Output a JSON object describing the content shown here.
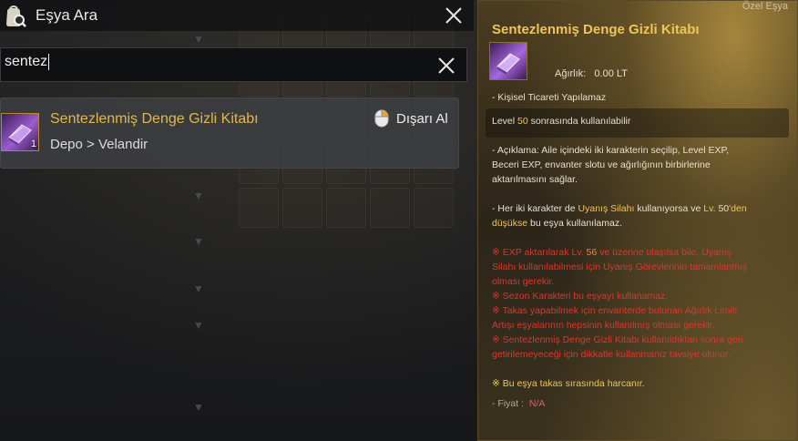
{
  "window": {
    "title": "Eşya Ara"
  },
  "search": {
    "value": "sentez"
  },
  "result": {
    "item_name": "Sentezlenmiş Denge Gizli Kitabı",
    "count": "1",
    "location": "Depo > Velandir",
    "action_label": "Dışarı Al"
  },
  "tooltip": {
    "category": "Özel Eşya",
    "title": "Sentezlenmiş Denge Gizli Kitabı",
    "weight_label": "Ağırlık:",
    "weight_value": "0.00 LT",
    "trade": "- Kişisel Ticareti Yapılamaz",
    "level_prefix": "Level",
    "level_value": "50",
    "level_suffix": "sonrasında kullanılabilir",
    "desc_line1": "- Açıklama: Aile içindeki iki karakterin seçilip, Level EXP,",
    "desc_line2": "Beceri EXP, envanter slotu ve ağırlığının birbirlerine",
    "desc_line3": "aktarılmasını sağlar.",
    "awak_pre": "- Her iki karakter de",
    "awak_weapon": "Uyanış Silahı",
    "awak_mid": "kullanıyorsa ve",
    "awak_lv": "Lv.",
    "awak_lvnum": "50",
    "awak_den": "'den",
    "awak_low": "düşükse",
    "awak_post": "bu eşya kullanılamaz.",
    "warn1_pre": "※ EXP aktarılarak Lv.",
    "warn1_num": "56",
    "warn1_post": "ve üzerine ulaşılsa bile, Uyanış",
    "warn1_line2": "Silahı kullanılabilmesi için Uyanış Görevlerinin tamamlanmış",
    "warn1_line3": "olması gerekir.",
    "warn2": "※ Sezon Karakteri bu eşyayı kullanamaz.",
    "warn3_line1": "※ Takas yapabilmek için envanterde bulunan Ağırlık Limiti",
    "warn3_line2": "Artışı eşyalarının hepsinin kullanılmış olması gerekir.",
    "warn4_line1": "※ Sentezlenmiş Denge Gizli Kitabı kullanıldıktan sonra geri",
    "warn4_line2": "getirilemeyeceği için dikkatle kullanmanız tavsiye olunur.",
    "consumed": "※ Bu eşya takas sırasında harcanır.",
    "price_label": "- Fiyat :",
    "price_value": "N/A"
  },
  "icons": {
    "title": "bag-search-icon",
    "close": "close-icon",
    "clear": "clear-icon",
    "item": "purple-book-icon",
    "mouse": "right-click-mouse-icon"
  },
  "colors": {
    "item_name": "#e2b84a",
    "tooltip_title": "#f0c45a",
    "warning": "#e0342b"
  }
}
